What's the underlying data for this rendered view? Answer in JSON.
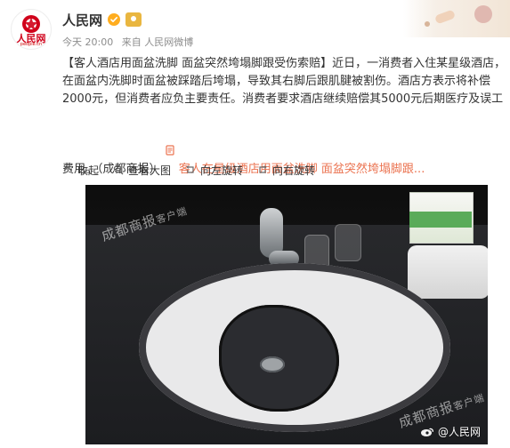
{
  "header": {
    "account_name": "人民网",
    "avatar_text": "人民网",
    "avatar_subtext": "people.cn",
    "time": "今天 20:00",
    "source": "来自 人民网微博"
  },
  "post": {
    "text_before_link": "【客人酒店用面盆洗脚 面盆突然垮塌脚跟受伤索赔】近日，一消费者入住某星级酒店，在面盆内洗脚时面盆被踩踏后垮塌，导致其右脚后跟肌腱被割伤。酒店方表示将补偿2000元，但消费者应负主要责任。消费者要求酒店继续赔偿其5000元后期医疗及误工费用。（成都商报）",
    "link_text": "客人在星级酒店用面盆洗脚 面盆突然垮塌脚跟...",
    "link_icon": "document-icon"
  },
  "toolbar": {
    "collapse": "收起",
    "view_large": "查看大图",
    "rotate_left": "向左旋转",
    "rotate_right": "向右旋转"
  },
  "image": {
    "watermark_main": "成都商报",
    "watermark_client": "客户端",
    "weibo_watermark": "@人民网"
  },
  "colors": {
    "link": "#eb7350",
    "text": "#333333",
    "meta": "#8c8c8c",
    "verified": "#ffad1f"
  }
}
